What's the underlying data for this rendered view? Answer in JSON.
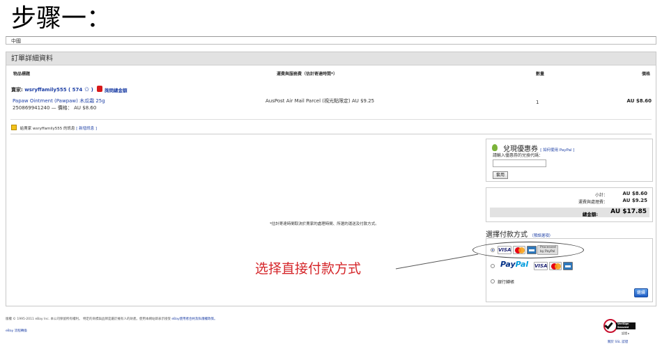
{
  "slide_title": "步骤一：",
  "address": {
    "country": "中國"
  },
  "panel": {
    "title": "訂單詳細資料",
    "columns": {
      "item": "物品標題",
      "shipping": "運費與服務費（估計寄達時間*）",
      "quantity": "數量",
      "price": "價格"
    }
  },
  "order": {
    "seller_prefix": "賣家:",
    "seller_name": "wsryffamily555",
    "feedback": "( 574",
    "feedback_close": ")",
    "contact_seller": "詢問總金額",
    "item_title": "Papaw Ointment (Pawpaw) 木瓜霜 25g",
    "item_number": "250869941240 — 價格： AU $8.60",
    "shipping_service": "AusPost Air Mail Parcel (視光點限定) AU $9.25",
    "quantity": "1",
    "price": "AU $8.60",
    "message_note": "給賣家 wsryffamily555 的訊息",
    "message_link": "[ 新增訊息 ]"
  },
  "coupon": {
    "title": "兌現優惠券",
    "link": "[ 如何使用 PayPal ]",
    "label": "請輸入優惠券的兌換代碼：",
    "input_value": "",
    "apply_button": "套用"
  },
  "totals": {
    "subtotal_label": "小計：",
    "subtotal_value": "AU $8.60",
    "shipping_label": "運費與處理費：",
    "shipping_value": "AU $9.25",
    "total_label": "總金額:",
    "total_value": "AU $17.85"
  },
  "delivery_note": "*估計寄達時間取決於賣家的處理時間、所選的運送及付款方式。",
  "payment": {
    "title": "選擇付款方式",
    "title_link": "（預設選項）",
    "processed_badge": "Processed by PayPal",
    "paypal_p1": "Pay",
    "paypal_p2": "Pal",
    "visa_label": "VISA",
    "bank_transfer": "銀行轉帳",
    "continue_button": "繼續"
  },
  "annotation": {
    "text": "选择直接付款方式"
  },
  "footer": {
    "copyright": "版權 © 1995-2011 eBay Inc. 本公司保留所有權利。 特定的商標與品牌是屬於擁有人的財產。使用本網站即表示接受",
    "agreement_link": "eBay使用者合約及私隱權政策。",
    "bottom_link": "eBay 流程轉換"
  },
  "verisign": {
    "badge": "VeriSign Secured",
    "small": "認證 ▸",
    "ssl_link": "關於 SSL 認證"
  },
  "colors": {
    "link": "#1d3fa5",
    "annotation": "#d5262a",
    "header_bg": "#e2e2e2"
  }
}
